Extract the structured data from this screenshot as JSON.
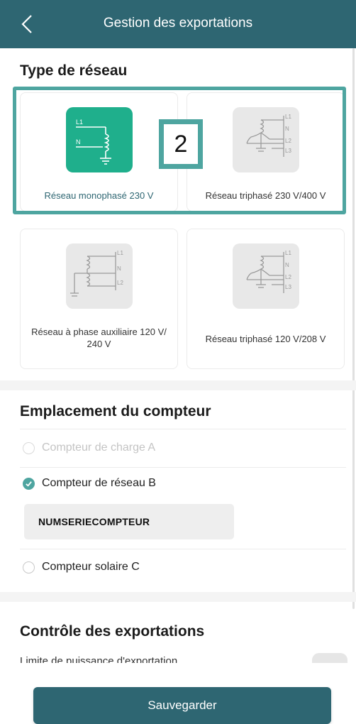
{
  "header": {
    "title": "Gestion des exportations",
    "background": "#2e6672"
  },
  "network_type": {
    "title": "Type de réseau",
    "options": [
      {
        "label": "Réseau monophasé 230 V",
        "icon": "single-phase-icon",
        "selected": true
      },
      {
        "label": "Réseau triphasé 230 V/400 V",
        "icon": "three-phase-icon",
        "selected": false
      },
      {
        "label": "Réseau à phase auxiliaire 120 V/ 240 V",
        "icon": "split-phase-icon",
        "selected": false
      },
      {
        "label": "Réseau triphasé 120 V/208 V",
        "icon": "three-phase-icon",
        "selected": false
      }
    ],
    "marker": "2"
  },
  "meter_location": {
    "title": "Emplacement du compteur",
    "options": [
      {
        "label": "Compteur de charge A",
        "state": "disabled"
      },
      {
        "label": "Compteur de réseau B",
        "state": "checked"
      },
      {
        "label": "Compteur solaire C",
        "state": "unchecked"
      }
    ],
    "serial_value": "NUMSERIECOMPTEUR"
  },
  "export_control": {
    "title": "Contrôle des exportations",
    "partial_label": "Limite de puissance d'exportation"
  },
  "footer": {
    "save_label": "Sauvegarder"
  },
  "colors": {
    "accent": "#4ea5a0",
    "primary": "#2e6672"
  }
}
